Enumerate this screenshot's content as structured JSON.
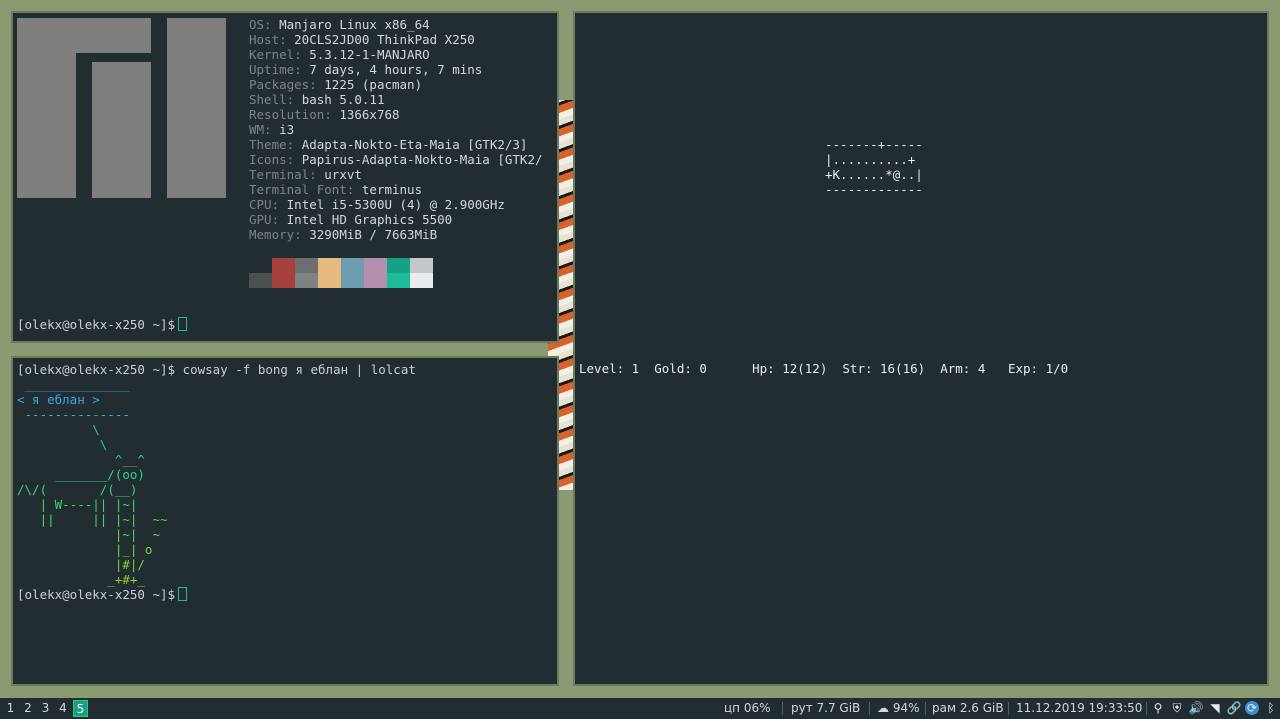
{
  "neofetch": {
    "info": [
      {
        "k": "OS: ",
        "v": "Manjaro Linux x86_64"
      },
      {
        "k": "Host: ",
        "v": "20CLS2JD00 ThinkPad X250"
      },
      {
        "k": "Kernel: ",
        "v": "5.3.12-1-MANJARO"
      },
      {
        "k": "Uptime: ",
        "v": "7 days, 4 hours, 7 mins"
      },
      {
        "k": "Packages: ",
        "v": "1225 (pacman)"
      },
      {
        "k": "Shell: ",
        "v": "bash 5.0.11"
      },
      {
        "k": "Resolution: ",
        "v": "1366x768"
      },
      {
        "k": "WM: ",
        "v": "i3"
      },
      {
        "k": "Theme: ",
        "v": "Adapta-Nokto-Eta-Maia [GTK2/3]"
      },
      {
        "k": "Icons: ",
        "v": "Papirus-Adapta-Nokto-Maia [GTK2/"
      },
      {
        "k": "Terminal: ",
        "v": "urxvt"
      },
      {
        "k": "Terminal Font: ",
        "v": "terminus"
      },
      {
        "k": "CPU: ",
        "v": "Intel i5-5300U (4) @ 2.900GHz"
      },
      {
        "k": "GPU: ",
        "v": "Intel HD Graphics 5500"
      },
      {
        "k": "Memory: ",
        "v": "3290MiB / 7663MiB"
      }
    ],
    "swatches": [
      {
        "top": "#222d32",
        "bot": "#4a5050"
      },
      {
        "top": "#a6413d",
        "bot": "#a6413d"
      },
      {
        "top": "#6b6f6f",
        "bot": "#7e8282"
      },
      {
        "top": "#e6b97c",
        "bot": "#e6b97c"
      },
      {
        "top": "#6b9cb0",
        "bot": "#6b9cb0"
      },
      {
        "top": "#b48ead",
        "bot": "#b48ead"
      },
      {
        "top": "#16a085",
        "bot": "#1abc9c"
      },
      {
        "top": "#c4c8c9",
        "bot": "#e8ecee"
      }
    ],
    "prompt": "[olekx@olekx-x250 ~]$"
  },
  "cowsay": {
    "command_prompt": "[olekx@olekx-x250 ~]$",
    "command": " cowsay -f bong я еблан | lolcat",
    "art": [
      {
        "t": " ______________",
        "c": "#3b8fd9"
      },
      {
        "t": "< я еблан >",
        "c": "#3aa6e0"
      },
      {
        "t": " --------------",
        "c": "#3bb0d6"
      },
      {
        "t": "          \\",
        "c": "#33bdbf"
      },
      {
        "t": "           \\",
        "c": "#2fc4b0"
      },
      {
        "t": "             ^__^",
        "c": "#2ec9a0"
      },
      {
        "t": "     _______/(oo)",
        "c": "#2ecf8e"
      },
      {
        "t": "/\\/(       /(__)",
        "c": "#36d27c"
      },
      {
        "t": "   | W----|| |~|",
        "c": "#41d46a"
      },
      {
        "t": "   ||     || |~|  ~~",
        "c": "#4fd65a"
      },
      {
        "t": "             |~|  ~",
        "c": "#5bd64c"
      },
      {
        "t": "             |_| o",
        "c": "#6ad640"
      },
      {
        "t": "             |#|/",
        "c": "#7cd336"
      },
      {
        "t": "            _+#+_",
        "c": "#8ccf2e"
      }
    ],
    "prompt": "[olekx@olekx-x250 ~]$"
  },
  "rogue": {
    "map": [
      "-------+-----",
      "|..........+",
      "+K......*@..|",
      "-------------"
    ],
    "status": "Level: 1  Gold: 0      Hp: 12(12)  Str: 16(16)  Arm: 4   Exp: 1/0"
  },
  "bar": {
    "workspaces": [
      "1",
      "2",
      "3",
      "4",
      "5"
    ],
    "active_workspace": "5",
    "cpu": "цп  06%",
    "root": "рут 7.7 GiB",
    "battery": "94%",
    "ram": "рам 2.6 GiB",
    "datetime": "11.12.2019 19:33:50"
  }
}
